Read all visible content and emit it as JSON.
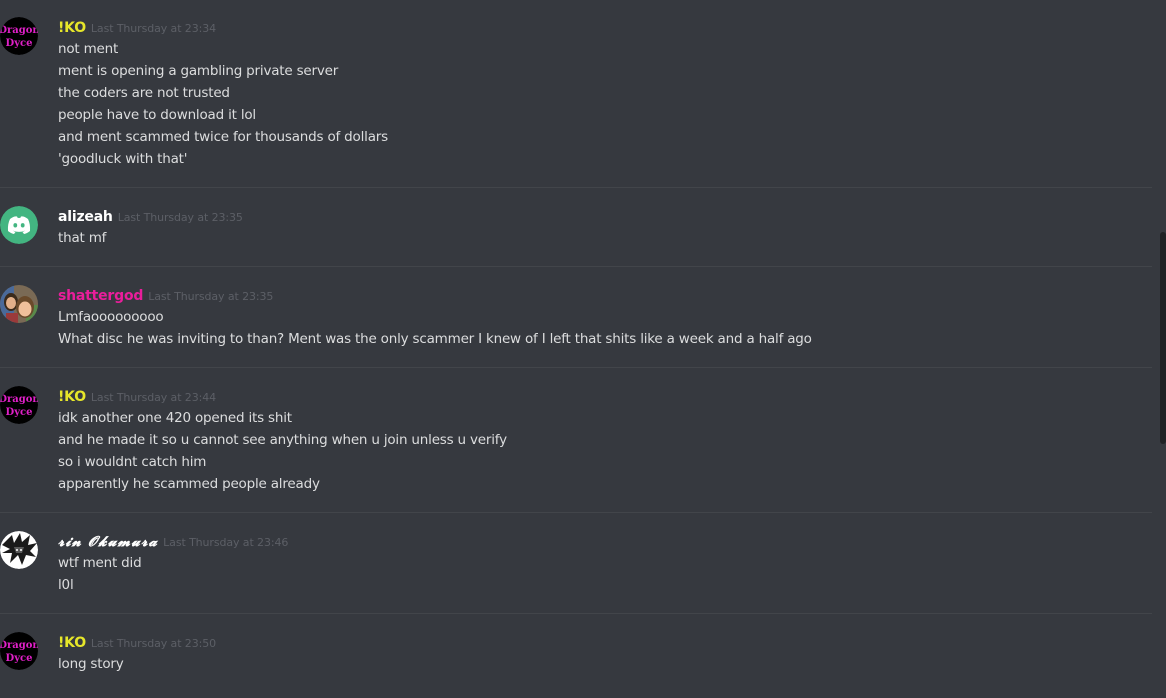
{
  "colors": {
    "background": "#36393f",
    "ko_name": "#e6e62a",
    "alizeah_name": "#ffffff",
    "shattergod_name": "#e91e9b",
    "rin_name": "#ffffff",
    "discord_avatar": "#43b581",
    "timestamp": "#5c5f66",
    "text": "#dcddde"
  },
  "messages": [
    {
      "author": "!KO",
      "avatar_icon": "dragon-dyce-avatar-icon",
      "avatar_text_1": "Dragon",
      "avatar_text_2": "Dyce",
      "timestamp": "Last Thursday at 23:34",
      "lines": [
        "not ment",
        "ment is opening a  gambling private server",
        "the  coders are not trusted",
        "people have to download it lol",
        "and ment scammed  twice for thousands of dollars",
        "'goodluck with that'"
      ]
    },
    {
      "author": "alizeah",
      "avatar_icon": "discord-logo-icon",
      "timestamp": "Last Thursday at 23:35",
      "lines": [
        "that mf"
      ]
    },
    {
      "author": "shattergod",
      "avatar_icon": "photo-avatar-icon",
      "timestamp": "Last Thursday at 23:35",
      "lines": [
        "Lmfaooooooooo",
        "What disc he was inviting to than?   Ment was the only scammer I knew of I left that shits like a week and a half ago"
      ]
    },
    {
      "author": "!KO",
      "avatar_icon": "dragon-dyce-avatar-icon",
      "avatar_text_1": "Dragon",
      "avatar_text_2": "Dyce",
      "timestamp": "Last Thursday at 23:44",
      "lines": [
        "idk another one  420 opened  its shit",
        "and he made it so u cannot see anything when u join unless u verify",
        "so i wouldnt catch him",
        "apparently he scammed people already"
      ]
    },
    {
      "author": "𝓻𝓲𝓷 𝓞𝓴𝓾𝓶𝓾𝓻𝓪",
      "author_plain": "Rin Okumura",
      "avatar_icon": "anime-avatar-icon",
      "timestamp": "Last Thursday at 23:46",
      "lines": [
        "wtf ment did",
        "l0l"
      ]
    },
    {
      "author": "!KO",
      "avatar_icon": "dragon-dyce-avatar-icon",
      "avatar_text_1": "Dragon",
      "avatar_text_2": "Dyce",
      "timestamp": "Last Thursday at 23:50",
      "lines": [
        "long story"
      ]
    }
  ]
}
